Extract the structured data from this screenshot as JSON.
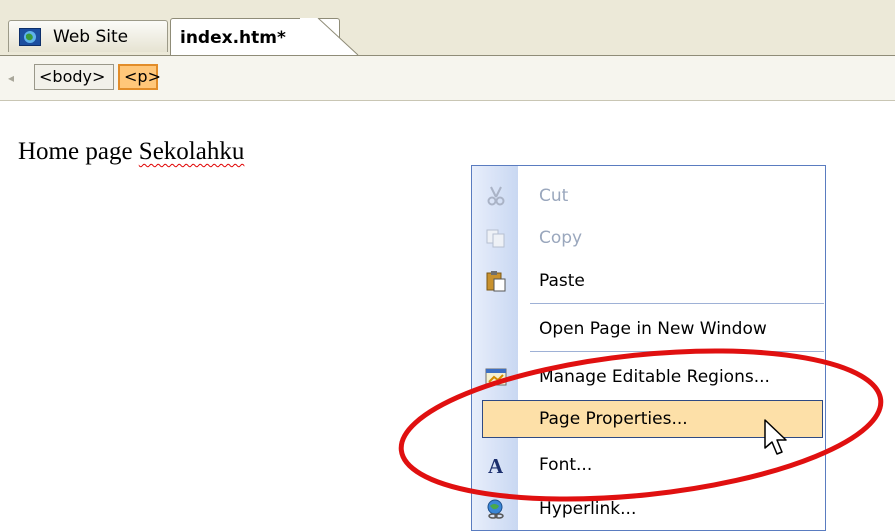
{
  "tabs": [
    {
      "label": "Web Site",
      "active": false
    },
    {
      "label": "index.htm*",
      "active": true
    }
  ],
  "tag_selector": {
    "tags": [
      "<body>",
      "<p>"
    ],
    "selected": "<p>"
  },
  "document": {
    "text_before": "Home page ",
    "text_misspelled": "Sekolahku"
  },
  "context_menu": {
    "items": [
      {
        "label": "Cut",
        "icon": "scissors-icon",
        "enabled": false
      },
      {
        "label": "Copy",
        "icon": "copy-icon",
        "enabled": false
      },
      {
        "label": "Paste",
        "icon": "paste-icon",
        "enabled": true
      },
      {
        "label": "Open Page in New Window",
        "icon": "",
        "enabled": true
      },
      {
        "label": "Manage Editable Regions...",
        "icon": "editable-regions-icon",
        "enabled": true
      },
      {
        "label": "Page Properties...",
        "icon": "",
        "enabled": true,
        "highlighted": true
      },
      {
        "label": "Font...",
        "icon": "font-icon",
        "enabled": true
      },
      {
        "label": "Hyperlink...",
        "icon": "hyperlink-icon",
        "enabled": true
      }
    ]
  },
  "colors": {
    "annotation": "#e01010",
    "highlight": "#fde0a8",
    "menu_border": "#5a7cc0"
  }
}
